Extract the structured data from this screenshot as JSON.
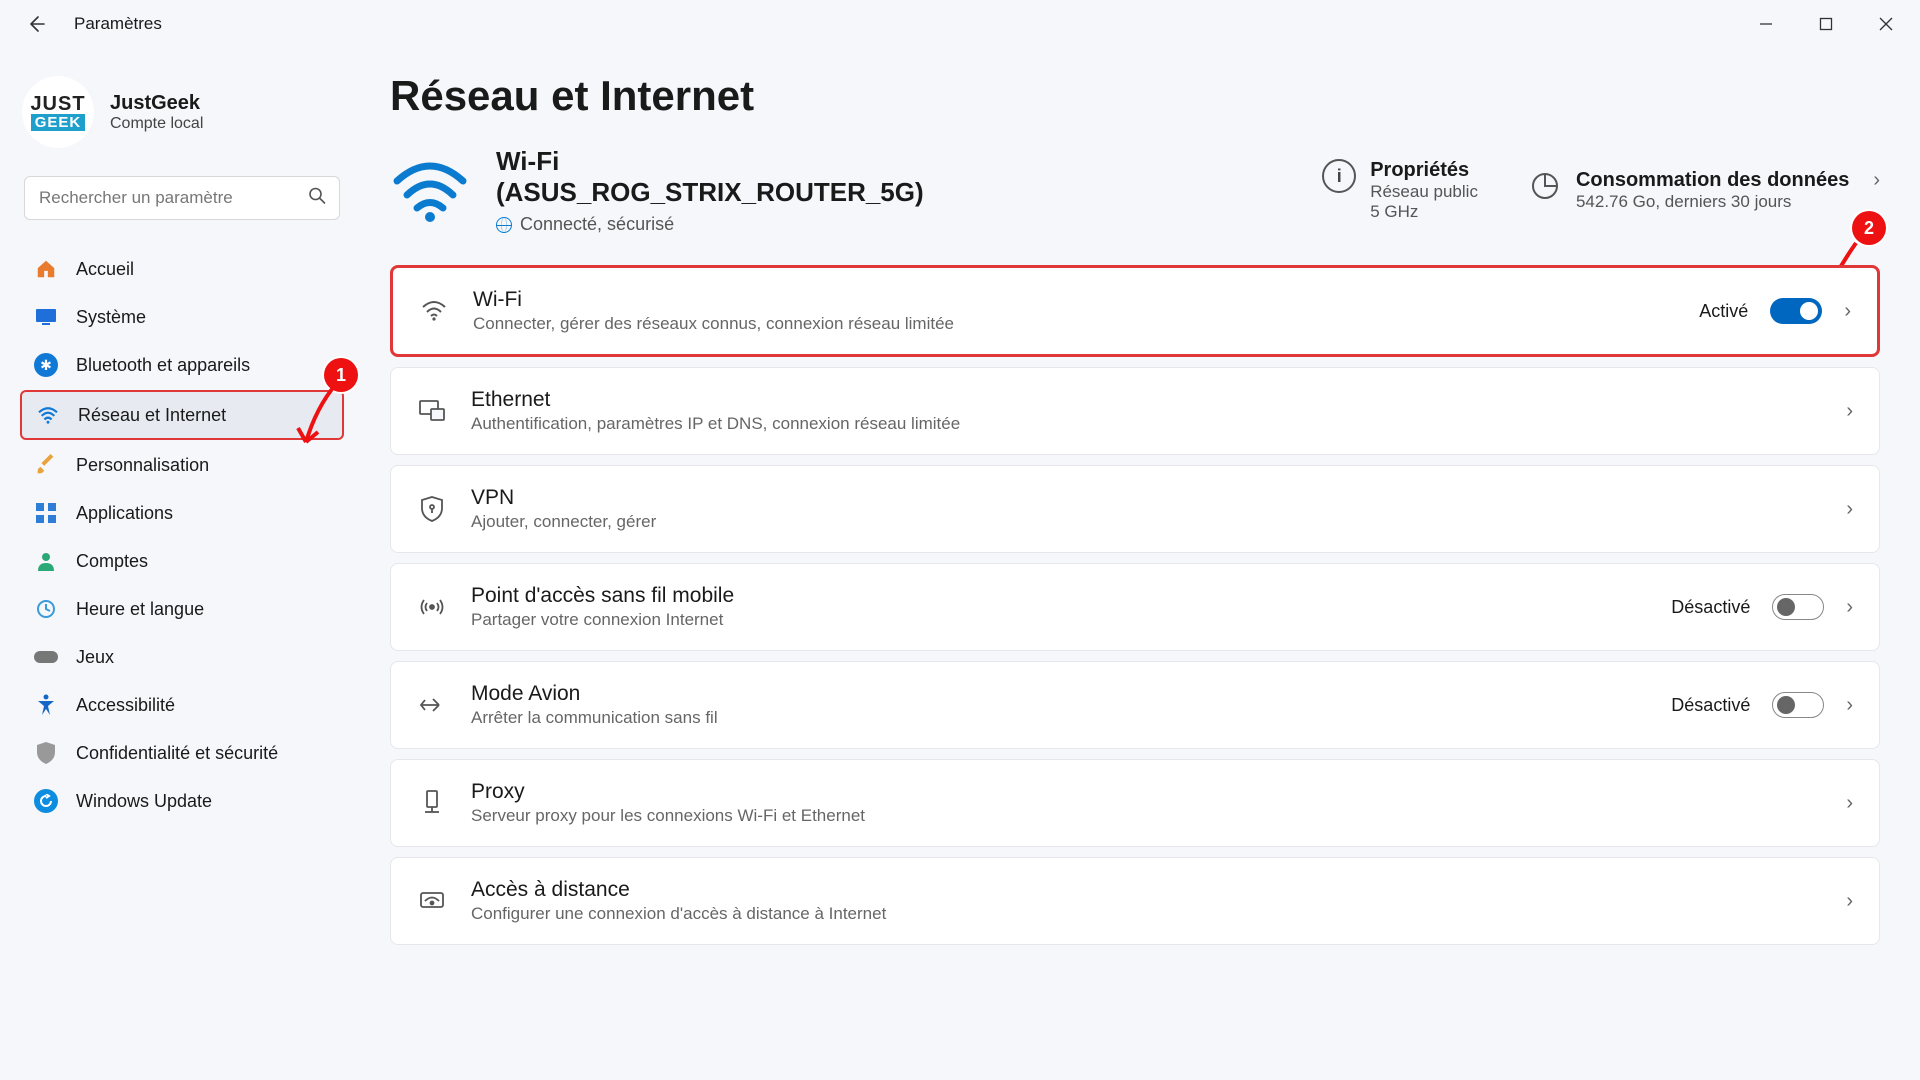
{
  "window": {
    "app_title": "Paramètres"
  },
  "profile": {
    "name": "JustGeek",
    "sub": "Compte local"
  },
  "search": {
    "placeholder": "Rechercher un paramètre"
  },
  "sidebar": {
    "items": [
      {
        "label": "Accueil"
      },
      {
        "label": "Système"
      },
      {
        "label": "Bluetooth et appareils"
      },
      {
        "label": "Réseau et Internet"
      },
      {
        "label": "Personnalisation"
      },
      {
        "label": "Applications"
      },
      {
        "label": "Comptes"
      },
      {
        "label": "Heure et langue"
      },
      {
        "label": "Jeux"
      },
      {
        "label": "Accessibilité"
      },
      {
        "label": "Confidentialité et sécurité"
      },
      {
        "label": "Windows Update"
      }
    ]
  },
  "page": {
    "title": "Réseau et Internet"
  },
  "status": {
    "title": "Wi-Fi",
    "ssid": "(ASUS_ROG_STRIX_ROUTER_5G)",
    "sub": "Connecté, sécurisé"
  },
  "info": {
    "properties": {
      "title": "Propriétés",
      "line1": "Réseau public",
      "line2": "5 GHz"
    },
    "data": {
      "title": "Consommation des données",
      "line1": "542.76 Go, derniers 30 jours"
    }
  },
  "cards": [
    {
      "title": "Wi-Fi",
      "sub": "Connecter, gérer des réseaux connus, connexion réseau limitée",
      "state": "Activé",
      "toggle": "on"
    },
    {
      "title": "Ethernet",
      "sub": "Authentification, paramètres IP et DNS, connexion réseau limitée"
    },
    {
      "title": "VPN",
      "sub": "Ajouter, connecter, gérer"
    },
    {
      "title": "Point d'accès sans fil mobile",
      "sub": "Partager votre connexion Internet",
      "state": "Désactivé",
      "toggle": "off"
    },
    {
      "title": "Mode Avion",
      "sub": "Arrêter la communication sans fil",
      "state": "Désactivé",
      "toggle": "off"
    },
    {
      "title": "Proxy",
      "sub": "Serveur proxy pour les connexions Wi-Fi et Ethernet"
    },
    {
      "title": "Accès à distance",
      "sub": "Configurer une connexion d'accès à distance à Internet"
    }
  ],
  "annotations": {
    "badge1": "1",
    "badge2": "2"
  }
}
